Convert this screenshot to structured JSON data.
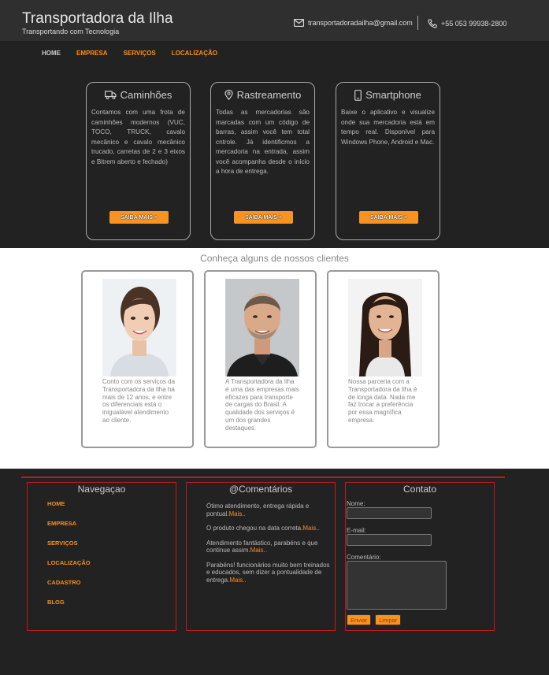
{
  "header": {
    "title": "Transportadora da Ilha",
    "subtitle": "Transportando com Tecnologia",
    "email": "transportadoradailha@gmail.com",
    "phone": "+55 053 99938-2800"
  },
  "nav": {
    "items": [
      "HOME",
      "EMPRESA",
      "SERVIÇOS",
      "LOCALIZAÇÃO"
    ]
  },
  "services": [
    {
      "icon": "truck-icon",
      "title": "Caminhões",
      "text": "Contamos com uma frota de caminhões modernos (VUC, TOCO, TRUCK, cavalo mecânico e cavalo mecânico trucado, carretas de 2 e 3 eixos e Bitrem aberto e fechado)",
      "button": "SAIBA MAIS >"
    },
    {
      "icon": "location-pin-icon",
      "title": "Rastreamento",
      "text": "Todas as mercadorias são marcadas com um código de barras, assim você tem total cntrole. Já identificmos a mercadoria na entrada, assim você acompanha desde o início a hora de entrega.",
      "button": "SAIBA MAIS >"
    },
    {
      "icon": "smartphone-icon",
      "title": "Smartphone",
      "text": "Baixe o aplicativo e visualize onde sua mercadoria está em tempo real. Disponível para Windows Phone, Android e Mac.",
      "button": "SAIBA MAIS >"
    }
  ],
  "clients": {
    "title": "Conheça alguns de nossos clientes",
    "items": [
      {
        "text": "Conto com os serviços da Transportadora da Ilha há mais de 12 anos, e entre os diferenciais está o inigualável atendimento ao cliente."
      },
      {
        "text": "A Transportadora da Ilha é uma das empresas mais eficazes para transporte de cargas do Brasil. A qualidade dos serviços é um dos grandes destaques."
      },
      {
        "text": "Nossa parceria com a Transportadora da Ilha é de longa data. Nada me faz trocar a preferência por essa magnífica empresa."
      }
    ]
  },
  "footer": {
    "nav_title": "Navegaçao",
    "nav_items": [
      "HOME",
      "EMPRESA",
      "SERVIÇOS",
      "LOCALIZAÇÃO",
      "CADASTRO",
      "BLOG"
    ],
    "comments_title": "@Comentários",
    "comments": [
      {
        "text": "Ótimo atendimento, entrega rápida e pontual.",
        "more": "Mais.."
      },
      {
        "text": "O produto chegou na data correta.",
        "more": "Mais.."
      },
      {
        "text": "Atendimento fantástico, parabéns e que continue assim.",
        "more": "Mais.."
      },
      {
        "text": "Parabéns! funcionários muito bem treinados e educados, sem dizer a pontualidade de entrega.",
        "more": "Mais.."
      }
    ],
    "contact_title": "Contato",
    "name_label": "Nome:",
    "email_label": "E-mail:",
    "comment_label": "Comentário:",
    "send_label": "Enviar",
    "clear_label": "Limpar"
  },
  "colors": {
    "accent": "#f7931e",
    "footer_border": "#c01a1a",
    "background": "#222222"
  }
}
